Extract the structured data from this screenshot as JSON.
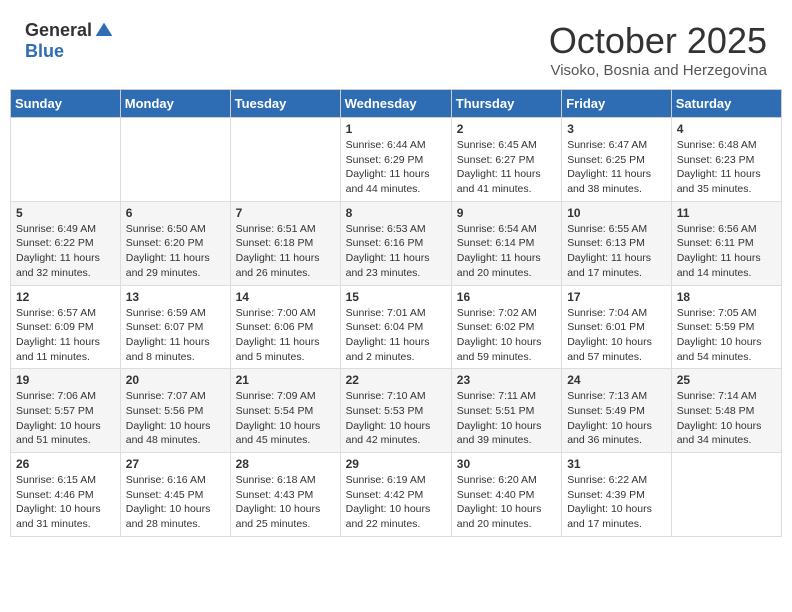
{
  "logo": {
    "general": "General",
    "blue": "Blue"
  },
  "title": {
    "month": "October 2025",
    "location": "Visoko, Bosnia and Herzegovina"
  },
  "weekdays": [
    "Sunday",
    "Monday",
    "Tuesday",
    "Wednesday",
    "Thursday",
    "Friday",
    "Saturday"
  ],
  "weeks": [
    [
      {
        "day": "",
        "info": ""
      },
      {
        "day": "",
        "info": ""
      },
      {
        "day": "",
        "info": ""
      },
      {
        "day": "1",
        "info": "Sunrise: 6:44 AM\nSunset: 6:29 PM\nDaylight: 11 hours and 44 minutes."
      },
      {
        "day": "2",
        "info": "Sunrise: 6:45 AM\nSunset: 6:27 PM\nDaylight: 11 hours and 41 minutes."
      },
      {
        "day": "3",
        "info": "Sunrise: 6:47 AM\nSunset: 6:25 PM\nDaylight: 11 hours and 38 minutes."
      },
      {
        "day": "4",
        "info": "Sunrise: 6:48 AM\nSunset: 6:23 PM\nDaylight: 11 hours and 35 minutes."
      }
    ],
    [
      {
        "day": "5",
        "info": "Sunrise: 6:49 AM\nSunset: 6:22 PM\nDaylight: 11 hours and 32 minutes."
      },
      {
        "day": "6",
        "info": "Sunrise: 6:50 AM\nSunset: 6:20 PM\nDaylight: 11 hours and 29 minutes."
      },
      {
        "day": "7",
        "info": "Sunrise: 6:51 AM\nSunset: 6:18 PM\nDaylight: 11 hours and 26 minutes."
      },
      {
        "day": "8",
        "info": "Sunrise: 6:53 AM\nSunset: 6:16 PM\nDaylight: 11 hours and 23 minutes."
      },
      {
        "day": "9",
        "info": "Sunrise: 6:54 AM\nSunset: 6:14 PM\nDaylight: 11 hours and 20 minutes."
      },
      {
        "day": "10",
        "info": "Sunrise: 6:55 AM\nSunset: 6:13 PM\nDaylight: 11 hours and 17 minutes."
      },
      {
        "day": "11",
        "info": "Sunrise: 6:56 AM\nSunset: 6:11 PM\nDaylight: 11 hours and 14 minutes."
      }
    ],
    [
      {
        "day": "12",
        "info": "Sunrise: 6:57 AM\nSunset: 6:09 PM\nDaylight: 11 hours and 11 minutes."
      },
      {
        "day": "13",
        "info": "Sunrise: 6:59 AM\nSunset: 6:07 PM\nDaylight: 11 hours and 8 minutes."
      },
      {
        "day": "14",
        "info": "Sunrise: 7:00 AM\nSunset: 6:06 PM\nDaylight: 11 hours and 5 minutes."
      },
      {
        "day": "15",
        "info": "Sunrise: 7:01 AM\nSunset: 6:04 PM\nDaylight: 11 hours and 2 minutes."
      },
      {
        "day": "16",
        "info": "Sunrise: 7:02 AM\nSunset: 6:02 PM\nDaylight: 10 hours and 59 minutes."
      },
      {
        "day": "17",
        "info": "Sunrise: 7:04 AM\nSunset: 6:01 PM\nDaylight: 10 hours and 57 minutes."
      },
      {
        "day": "18",
        "info": "Sunrise: 7:05 AM\nSunset: 5:59 PM\nDaylight: 10 hours and 54 minutes."
      }
    ],
    [
      {
        "day": "19",
        "info": "Sunrise: 7:06 AM\nSunset: 5:57 PM\nDaylight: 10 hours and 51 minutes."
      },
      {
        "day": "20",
        "info": "Sunrise: 7:07 AM\nSunset: 5:56 PM\nDaylight: 10 hours and 48 minutes."
      },
      {
        "day": "21",
        "info": "Sunrise: 7:09 AM\nSunset: 5:54 PM\nDaylight: 10 hours and 45 minutes."
      },
      {
        "day": "22",
        "info": "Sunrise: 7:10 AM\nSunset: 5:53 PM\nDaylight: 10 hours and 42 minutes."
      },
      {
        "day": "23",
        "info": "Sunrise: 7:11 AM\nSunset: 5:51 PM\nDaylight: 10 hours and 39 minutes."
      },
      {
        "day": "24",
        "info": "Sunrise: 7:13 AM\nSunset: 5:49 PM\nDaylight: 10 hours and 36 minutes."
      },
      {
        "day": "25",
        "info": "Sunrise: 7:14 AM\nSunset: 5:48 PM\nDaylight: 10 hours and 34 minutes."
      }
    ],
    [
      {
        "day": "26",
        "info": "Sunrise: 6:15 AM\nSunset: 4:46 PM\nDaylight: 10 hours and 31 minutes."
      },
      {
        "day": "27",
        "info": "Sunrise: 6:16 AM\nSunset: 4:45 PM\nDaylight: 10 hours and 28 minutes."
      },
      {
        "day": "28",
        "info": "Sunrise: 6:18 AM\nSunset: 4:43 PM\nDaylight: 10 hours and 25 minutes."
      },
      {
        "day": "29",
        "info": "Sunrise: 6:19 AM\nSunset: 4:42 PM\nDaylight: 10 hours and 22 minutes."
      },
      {
        "day": "30",
        "info": "Sunrise: 6:20 AM\nSunset: 4:40 PM\nDaylight: 10 hours and 20 minutes."
      },
      {
        "day": "31",
        "info": "Sunrise: 6:22 AM\nSunset: 4:39 PM\nDaylight: 10 hours and 17 minutes."
      },
      {
        "day": "",
        "info": ""
      }
    ]
  ]
}
